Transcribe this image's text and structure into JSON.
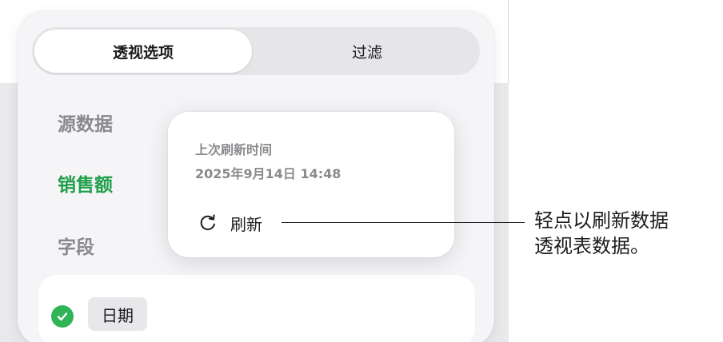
{
  "tabs": [
    {
      "label": "透视选项",
      "active": true
    },
    {
      "label": "过滤",
      "active": false
    }
  ],
  "source": {
    "heading": "源数据",
    "name": "销售额"
  },
  "fields": {
    "heading": "字段",
    "items": [
      {
        "label": "日期",
        "checked": true
      }
    ]
  },
  "popover": {
    "title": "上次刷新时间",
    "timestamp": "2025年9月14日 14:48",
    "refresh_label": "刷新",
    "refresh_icon": "refresh-icon"
  },
  "callout": {
    "line1": "轻点以刷新数据",
    "line2": "透视表数据。"
  },
  "colors": {
    "accent_green": "#1f9e4a",
    "check_green": "#30b457",
    "panel_bg": "#f5f5f7",
    "muted_text": "#8a8a8e"
  }
}
